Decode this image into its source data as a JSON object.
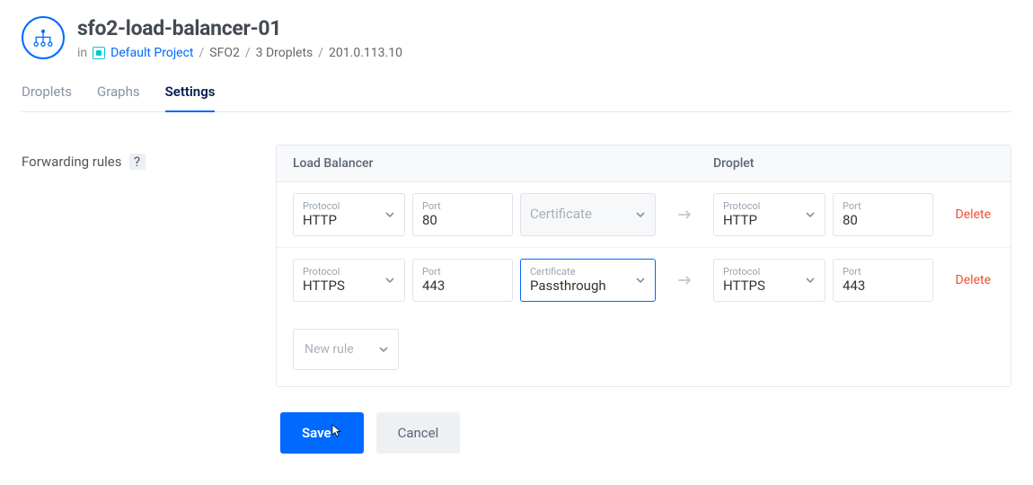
{
  "header": {
    "title": "sfo2-load-balancer-01",
    "in_label": "in",
    "project_name": "Default Project",
    "region": "SFO2",
    "droplets": "3 Droplets",
    "ip": "201.0.113.10"
  },
  "tabs": [
    {
      "label": "Droplets",
      "active": false
    },
    {
      "label": "Graphs",
      "active": false
    },
    {
      "label": "Settings",
      "active": true
    }
  ],
  "section": {
    "label": "Forwarding rules",
    "help": "?"
  },
  "table": {
    "col_lb": "Load Balancer",
    "col_droplet": "Droplet",
    "labels": {
      "protocol": "Protocol",
      "port": "Port",
      "certificate": "Certificate"
    },
    "cert_placeholder": "Certificate",
    "delete_label": "Delete",
    "new_rule_label": "New rule"
  },
  "rules": [
    {
      "lb_protocol": "HTTP",
      "lb_port": "80",
      "cert_value": "",
      "cert_disabled": true,
      "dr_protocol": "HTTP",
      "dr_port": "80"
    },
    {
      "lb_protocol": "HTTPS",
      "lb_port": "443",
      "cert_value": "Passthrough",
      "cert_disabled": false,
      "cert_focused": true,
      "dr_protocol": "HTTPS",
      "dr_port": "443"
    }
  ],
  "actions": {
    "save": "Save",
    "cancel": "Cancel"
  }
}
